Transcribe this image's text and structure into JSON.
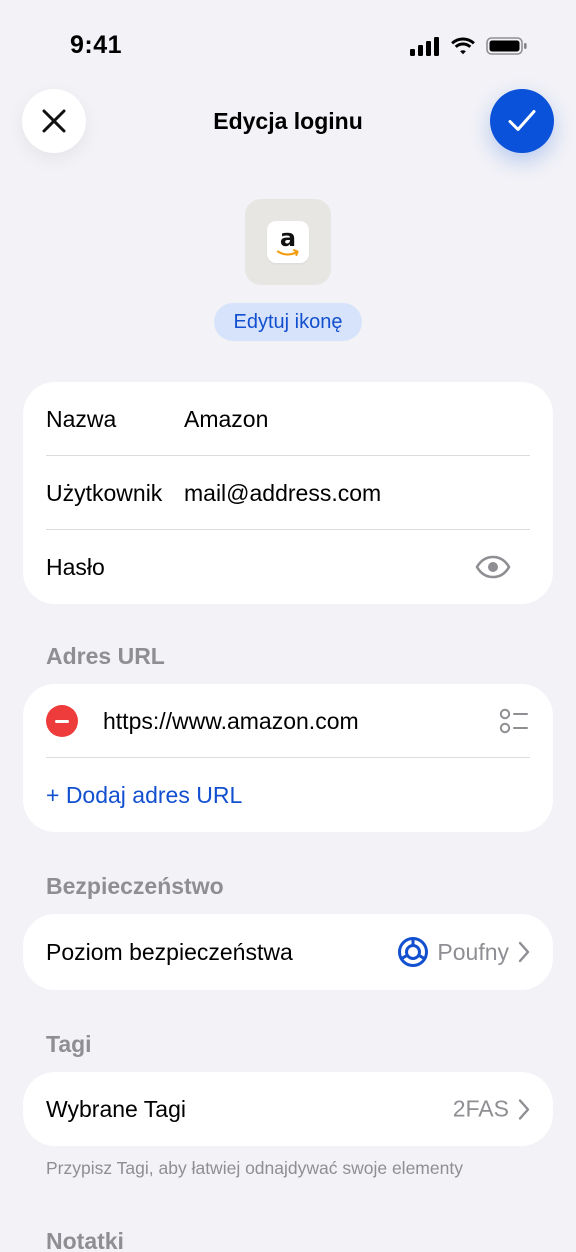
{
  "status_bar": {
    "time": "9:41"
  },
  "nav": {
    "title": "Edycja loginu"
  },
  "icon": {
    "glyph": "a",
    "edit_label": "Edytuj ikonę"
  },
  "credentials": {
    "name_label": "Nazwa",
    "name_value": "Amazon",
    "user_label": "Użytkownik",
    "user_value": "mail@address.com",
    "password_label": "Hasło"
  },
  "url_section": {
    "title": "Adres URL",
    "url": "https://www.amazon.com",
    "add_label": "+ Dodaj adres URL"
  },
  "security_section": {
    "title": "Bezpieczeństwo",
    "level_label": "Poziom bezpieczeństwa",
    "level_value": "Poufny"
  },
  "tags_section": {
    "title": "Tagi",
    "selected_label": "Wybrane Tagi",
    "selected_value": "2FAS",
    "hint": "Przypisz Tagi, aby łatwiej odnajdywać swoje elementy"
  },
  "notes_section": {
    "title": "Notatki"
  },
  "colors": {
    "background": "#f2f2f7",
    "accent": "#0a52d9",
    "link": "#1250d0",
    "destructive": "#ee3b3b",
    "secondary_text": "#8e8e93"
  },
  "icons": [
    "close-icon",
    "checkmark-icon",
    "eye-icon",
    "remove-icon",
    "list-icon",
    "security-level-icon",
    "chevron-right-icon",
    "signal-icon",
    "wifi-icon",
    "battery-icon"
  ]
}
